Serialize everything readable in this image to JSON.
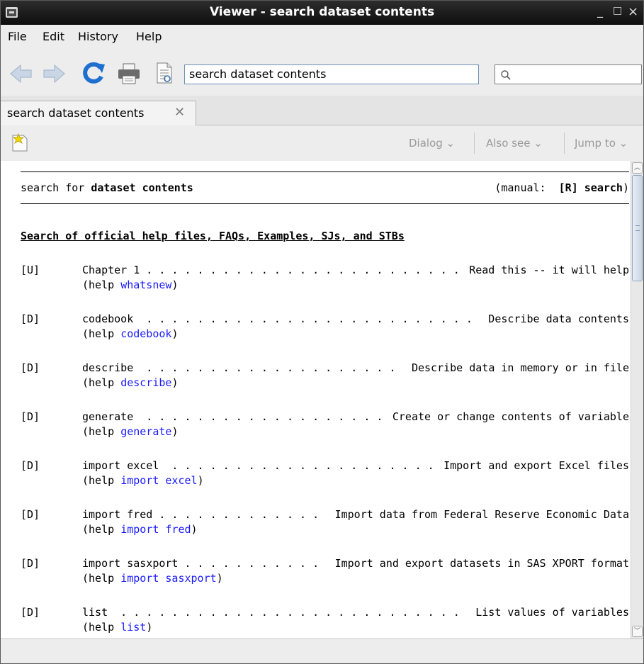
{
  "window": {
    "title": "Viewer - search dataset contents",
    "minimize": "_",
    "maximize": "□",
    "close": "×"
  },
  "menu": {
    "items": [
      "File",
      "Edit",
      "History",
      "Help"
    ]
  },
  "toolbar": {
    "url_value": "search dataset contents",
    "search_value": "",
    "icons": [
      "back-icon",
      "forward-icon",
      "refresh-icon",
      "print-icon",
      "document-icon",
      "search-icon"
    ]
  },
  "tabs": [
    {
      "label": "search dataset contents",
      "close": "✕"
    }
  ],
  "subtoolbar": {
    "dialog": "Dialog",
    "also_see": "Also see",
    "jump_to": "Jump to"
  },
  "content": {
    "header_prefix": "search for ",
    "header_term": "dataset contents",
    "manual_prefix": "(manual:  ",
    "manual_ref": "[R] search",
    "manual_suffix": ")",
    "section_title": "Search of official help files, FAQs, Examples, SJs, and STBs",
    "entries": [
      {
        "tag": "[U]",
        "name": "Chapter 1",
        "desc": "Read this -- it will help",
        "help_prefix": "(help ",
        "help_link": "whatsnew",
        "help_suffix": ")"
      },
      {
        "tag": "[D]",
        "name": "codebook",
        "desc": "Describe data contents",
        "help_prefix": "(help ",
        "help_link": "codebook",
        "help_suffix": ")"
      },
      {
        "tag": "[D]",
        "name": "describe",
        "desc": "Describe data in memory or in file",
        "help_prefix": "(help ",
        "help_link": "describe",
        "help_suffix": ")"
      },
      {
        "tag": "[D]",
        "name": "generate",
        "desc": "Create or change contents of variable",
        "help_prefix": "(help ",
        "help_link": "generate",
        "help_suffix": ")"
      },
      {
        "tag": "[D]",
        "name": "import excel",
        "desc": "Import and export Excel files",
        "help_prefix": "(help ",
        "help_link": "import excel",
        "help_suffix": ")"
      },
      {
        "tag": "[D]",
        "name": "import fred",
        "desc": "Import data from Federal Reserve Economic Data",
        "help_prefix": "(help ",
        "help_link": "import fred",
        "help_suffix": ")"
      },
      {
        "tag": "[D]",
        "name": "import sasxport",
        "desc": "Import and export datasets in SAS XPORT format",
        "help_prefix": "(help ",
        "help_link": "import sasxport",
        "help_suffix": ")"
      },
      {
        "tag": "[D]",
        "name": "list",
        "desc": "List values of variables",
        "help_prefix": "(help ",
        "help_link": "list",
        "help_suffix": ")"
      }
    ]
  },
  "colors": {
    "link": "#1a1aff",
    "titlebar": "#1a1a1a",
    "chrome": "#ededed"
  }
}
